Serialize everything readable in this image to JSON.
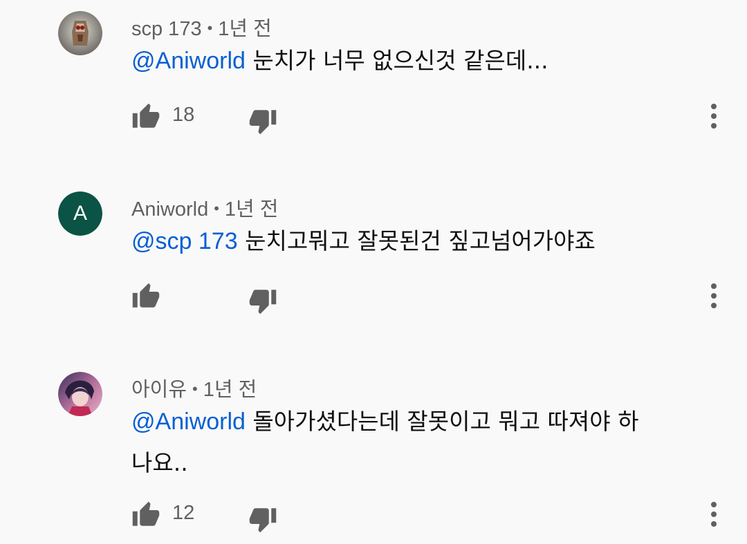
{
  "comments": [
    {
      "author": "scp 173",
      "separator": "•",
      "time": "1년 전",
      "mention": "@Aniworld",
      "text": "눈치가 너무 없으신것 같은데...",
      "likes": "18",
      "avatar_letter": "",
      "avatar_color": "#8a8a80"
    },
    {
      "author": "Aniworld",
      "separator": "•",
      "time": "1년 전",
      "mention": "@scp 173",
      "text": "눈치고뭐고 잘못된건 짚고넘어가야죠",
      "likes": "",
      "avatar_letter": "A",
      "avatar_color": "#0b5345"
    },
    {
      "author": "아이유",
      "separator": "•",
      "time": "1년 전",
      "mention": "@Aniworld",
      "text": "돌아가셨다는데 잘못이고 뭐고 따져야 하나요..",
      "likes": "12",
      "avatar_letter": "",
      "avatar_color": "#c86a9a"
    }
  ],
  "icons": {
    "like": "thumbs-up-icon",
    "dislike": "thumbs-down-icon",
    "more": "more-vert-icon"
  }
}
